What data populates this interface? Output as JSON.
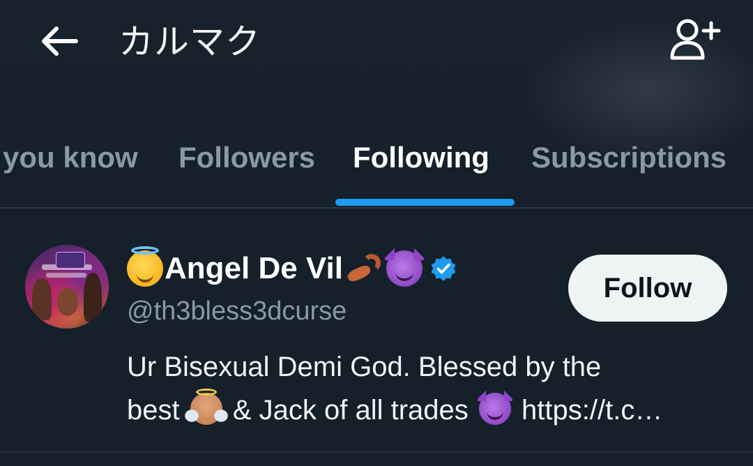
{
  "header": {
    "title": "カルマク",
    "back_icon": "arrow-left-icon",
    "action_icon": "person-plus-icon"
  },
  "tabs": [
    {
      "label": "you know",
      "active": false
    },
    {
      "label": "Followers",
      "active": false
    },
    {
      "label": "Following",
      "active": true
    },
    {
      "label": "Subscriptions",
      "active": false
    }
  ],
  "colors": {
    "background": "#15202b",
    "accent": "#1d9bf0",
    "muted_text": "#8b98a5",
    "divider": "#2a3541",
    "follow_button_bg": "#eff3f4"
  },
  "users": [
    {
      "display_name": "Angel De Vil",
      "name_emoji_prefix": "smiling-face-with-halo-emoji",
      "name_emoji_suffix": [
        "scorpion-emoji",
        "smiling-devil-emoji"
      ],
      "verified": true,
      "handle": "@th3bless3dcurse",
      "follow_label": "Follow",
      "bio": {
        "line1": "Ur Bisexual Demi God. Blessed by the",
        "line2_before": "best",
        "line2_middle": "& Jack of all trades",
        "line2_link": "https://t.c…",
        "emoji_1": "baby-angel-emoji",
        "emoji_2": "smiling-devil-emoji"
      }
    }
  ]
}
